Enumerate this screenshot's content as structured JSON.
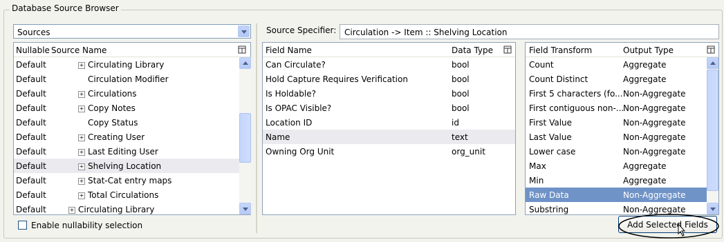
{
  "group_title": "Database Source Browser",
  "sources": {
    "dropdown_value": "Sources",
    "headers": {
      "nullable": "Nullable",
      "source_name": "Source Name"
    },
    "rows": [
      {
        "nullable": "Default",
        "name": "Circulating Library",
        "expandable": true,
        "indent": 1
      },
      {
        "nullable": "Default",
        "name": "Circulation Modifier",
        "expandable": false,
        "indent": 1
      },
      {
        "nullable": "Default",
        "name": "Circulations",
        "expandable": true,
        "indent": 1
      },
      {
        "nullable": "Default",
        "name": "Copy Notes",
        "expandable": true,
        "indent": 1
      },
      {
        "nullable": "Default",
        "name": "Copy Status",
        "expandable": false,
        "indent": 1
      },
      {
        "nullable": "Default",
        "name": "Creating User",
        "expandable": true,
        "indent": 1
      },
      {
        "nullable": "Default",
        "name": "Last Editing User",
        "expandable": true,
        "indent": 1
      },
      {
        "nullable": "Default",
        "name": "Shelving Location",
        "expandable": true,
        "indent": 1,
        "selected": true
      },
      {
        "nullable": "Default",
        "name": "Stat-Cat entry maps",
        "expandable": true,
        "indent": 1
      },
      {
        "nullable": "Default",
        "name": "Total Circulations",
        "expandable": true,
        "indent": 1
      },
      {
        "nullable": "Default",
        "name": "Circulating Library",
        "expandable": true,
        "indent": 0
      }
    ],
    "nullability_label": "Enable nullability selection"
  },
  "source_specifier": {
    "label": "Source Specifier:",
    "value": "Circulation -> Item :: Shelving Location"
  },
  "fields": {
    "headers": {
      "field_name": "Field Name",
      "data_type": "Data Type"
    },
    "rows": [
      {
        "name": "Can Circulate?",
        "type": "bool"
      },
      {
        "name": "Hold Capture Requires Verification",
        "type": "bool"
      },
      {
        "name": "Is Holdable?",
        "type": "bool"
      },
      {
        "name": "Is OPAC Visible?",
        "type": "bool"
      },
      {
        "name": "Location ID",
        "type": "id"
      },
      {
        "name": "Name",
        "type": "text",
        "selected": true
      },
      {
        "name": "Owning Org Unit",
        "type": "org_unit"
      }
    ]
  },
  "transforms": {
    "headers": {
      "transform": "Field Transform",
      "output": "Output Type"
    },
    "rows": [
      {
        "transform": "Count",
        "output": "Aggregate"
      },
      {
        "transform": "Count Distinct",
        "output": "Aggregate"
      },
      {
        "transform": "First 5 characters (fo...",
        "output": "Non-Aggregate"
      },
      {
        "transform": "First contiguous non-...",
        "output": "Non-Aggregate"
      },
      {
        "transform": "First Value",
        "output": "Non-Aggregate"
      },
      {
        "transform": "Last Value",
        "output": "Non-Aggregate"
      },
      {
        "transform": "Lower case",
        "output": "Non-Aggregate"
      },
      {
        "transform": "Max",
        "output": "Aggregate"
      },
      {
        "transform": "Min",
        "output": "Aggregate"
      },
      {
        "transform": "Raw Data",
        "output": "Non-Aggregate",
        "selected": true
      },
      {
        "transform": "Substring",
        "output": "Non-Aggregate"
      }
    ]
  },
  "add_button_label": "Add Selected Fields",
  "colors": {
    "selection": "#6f93c7",
    "scroll_button": "#c1d3fb",
    "panel_border": "#8ea1b8"
  },
  "icons": [
    "expand-icon",
    "column-picker-icon",
    "dropdown-arrow-icon",
    "scroll-up-icon",
    "scroll-down-icon",
    "mouse-cursor-icon"
  ]
}
